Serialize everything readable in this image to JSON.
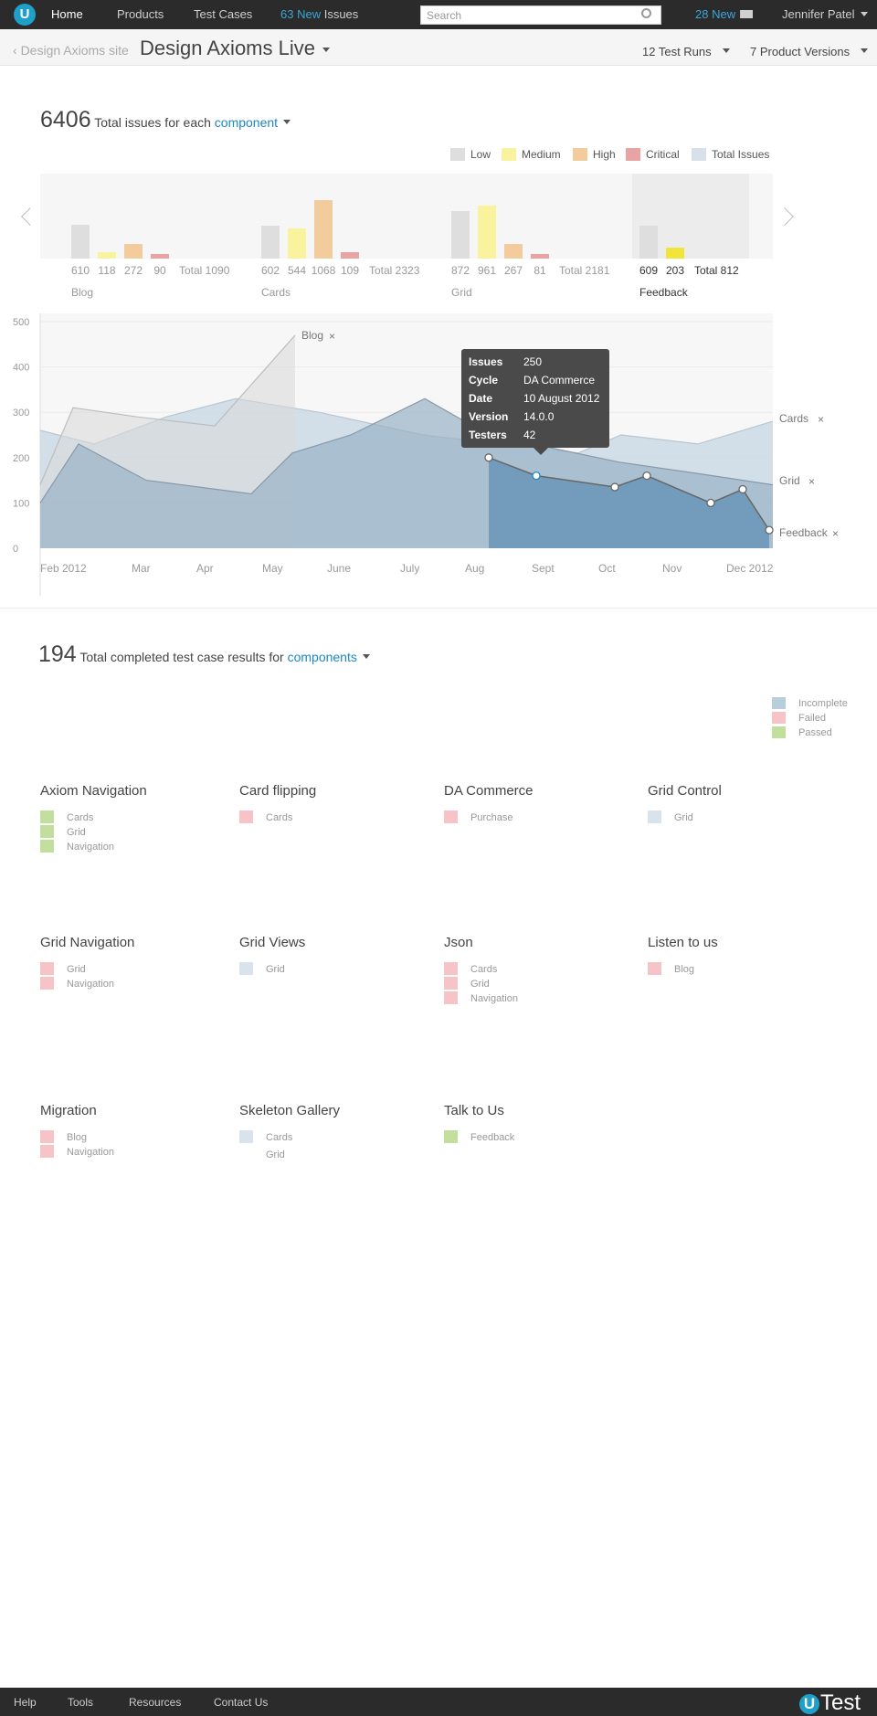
{
  "colors": {
    "brand": "#1ea0c8",
    "link": "#1e88c3",
    "low": "#dedede",
    "medium": "#f8f39c",
    "high": "#f2cc9c",
    "critical": "#eaa3a3",
    "total": "#d8e1ea",
    "feedback_medium": "#f2e53a",
    "incomplete": "#b9cedb",
    "failed": "#f6c3c6",
    "passed": "#c3df9d",
    "grid_sw": "#d8e3ec"
  },
  "topnav": {
    "logo": "U",
    "home": "Home",
    "products": "Products",
    "test_cases": "Test Cases",
    "issues_count": "63 New",
    "issues_label": "Issues",
    "search_placeholder": "Search",
    "messages_count": "28 New",
    "messages_icon": "envelope-icon",
    "user": "Jennifer Patel"
  },
  "subheader": {
    "back": "Design Axioms site",
    "title": "Design Axioms Live",
    "test_runs": "12 Test Runs",
    "product_versions": "7 Product Versions"
  },
  "issues": {
    "total": "6406",
    "label": "Total issues for each",
    "filter": "component",
    "legend": [
      {
        "label": "Low",
        "color": "#dedede"
      },
      {
        "label": "Medium",
        "color": "#f8f39c"
      },
      {
        "label": "High",
        "color": "#f2cc9c"
      },
      {
        "label": "Critical",
        "color": "#eaa3a3"
      },
      {
        "label": "Total Issues",
        "color": "#d8e1ea"
      }
    ],
    "groups": [
      {
        "name": "Blog",
        "low": "610",
        "medium": "118",
        "high": "272",
        "critical": "90",
        "total": "Total 1090"
      },
      {
        "name": "Cards",
        "low": "602",
        "medium": "544",
        "high": "1068",
        "critical": "109",
        "total": "Total 2323"
      },
      {
        "name": "Grid",
        "low": "872",
        "medium": "961",
        "high": "267",
        "critical": "81",
        "total": "Total 2181"
      },
      {
        "name": "Feedback",
        "low": "609",
        "medium": "203",
        "total": "Total 812"
      }
    ]
  },
  "chart_data": {
    "type": "area",
    "x": [
      "Feb 2012",
      "Mar",
      "Apr",
      "May",
      "June",
      "July",
      "Aug",
      "Sept",
      "Oct",
      "Nov",
      "Dec 2012"
    ],
    "y_ticks": [
      "500",
      "400",
      "300",
      "200",
      "100",
      "0"
    ],
    "ylim": [
      0,
      500
    ],
    "series": [
      {
        "name": "Blog",
        "values": [
          140,
          310,
          290,
          270,
          470
        ]
      },
      {
        "name": "Cards",
        "values": [
          260,
          230,
          290,
          330,
          300,
          250,
          210,
          250,
          230,
          280
        ]
      },
      {
        "name": "Grid",
        "values": [
          100,
          230,
          150,
          120,
          210,
          250,
          330,
          250,
          190,
          160,
          140
        ]
      },
      {
        "name": "Feedback",
        "values": [
          200,
          160,
          135,
          160,
          100,
          130,
          40
        ]
      }
    ],
    "tooltip": {
      "issues_key": "Issues",
      "issues": "250",
      "cycle_key": "Cycle",
      "cycle": "DA Commerce",
      "date_key": "Date",
      "date": "10 August 2012",
      "version_key": "Version",
      "version": "14.0.0",
      "testers_key": "Testers",
      "testers": "42"
    },
    "close_mark": "×"
  },
  "testcases": {
    "total": "194",
    "label": "Total completed test case results for",
    "filter": "components",
    "legend": [
      {
        "label": "Incomplete",
        "color": "#b9cedb"
      },
      {
        "label": "Failed",
        "color": "#f6c3c6"
      },
      {
        "label": "Passed",
        "color": "#c3df9d"
      }
    ],
    "components": [
      {
        "title": "Axiom Navigation",
        "items": [
          {
            "label": "Cards",
            "color": "#c3df9d"
          },
          {
            "label": "Grid",
            "color": "#c3df9d"
          },
          {
            "label": "Navigation",
            "color": "#c3df9d"
          }
        ]
      },
      {
        "title": "Card flipping",
        "items": [
          {
            "label": "Cards",
            "color": "#f6c3c6"
          }
        ]
      },
      {
        "title": "DA Commerce",
        "items": [
          {
            "label": "Purchase",
            "color": "#f6c3c6"
          }
        ]
      },
      {
        "title": "Grid Control",
        "items": [
          {
            "label": "Grid",
            "color": "#d8e3ec"
          }
        ]
      },
      {
        "title": "Grid Navigation",
        "items": [
          {
            "label": "Grid",
            "color": "#f6c3c6"
          },
          {
            "label": "Navigation",
            "color": "#f6c3c6"
          }
        ]
      },
      {
        "title": "Grid Views",
        "items": [
          {
            "label": "Grid",
            "color": "#d8e3ec"
          }
        ]
      },
      {
        "title": "Json",
        "items": [
          {
            "label": "Cards",
            "color": "#f6c3c6"
          },
          {
            "label": "Grid",
            "color": "#f6c3c6"
          },
          {
            "label": "Navigation",
            "color": "#f6c3c6"
          }
        ]
      },
      {
        "title": "Listen to us",
        "items": [
          {
            "label": "Blog",
            "color": "#f6c3c6"
          }
        ]
      },
      {
        "title": "Migration",
        "items": [
          {
            "label": "Blog",
            "color": "#f6c3c6"
          },
          {
            "label": "Navigation",
            "color": "#f6c3c6"
          }
        ]
      },
      {
        "title": "Skeleton Gallery",
        "items": [
          {
            "label": "Cards",
            "color": "#d8e3ec"
          },
          {
            "label": "Grid",
            "color": ""
          }
        ]
      },
      {
        "title": "Talk to Us",
        "items": [
          {
            "label": "Feedback",
            "color": "#c3df9d"
          }
        ]
      }
    ]
  },
  "footer": {
    "help": "Help",
    "tools": "Tools",
    "resources": "Resources",
    "contact": "Contact Us",
    "brand_u": "U",
    "brand": "Test"
  }
}
